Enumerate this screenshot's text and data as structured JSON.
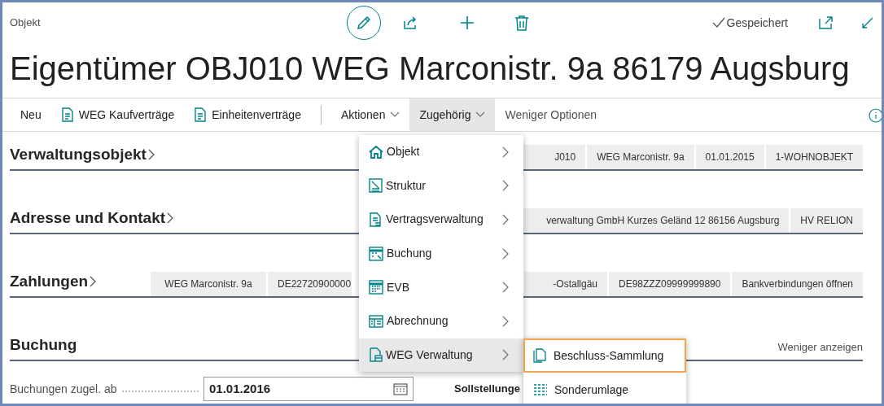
{
  "record_type": "Objekt",
  "save_status": "Gespeichert",
  "title": "Eigentümer OBJ010 WEG Marconistr. 9a 86179 Augsburg",
  "actions": [
    {
      "label": "Neu",
      "kind": "plain",
      "expanded": false
    },
    {
      "label": "WEG Kaufverträge",
      "kind": "icon",
      "expanded": false
    },
    {
      "label": "Einheitenverträge",
      "kind": "icon",
      "expanded": false
    },
    {
      "label": "Aktionen",
      "kind": "dropdown",
      "expanded": false
    },
    {
      "label": "Zugehörig",
      "kind": "dropdown",
      "expanded": true
    },
    {
      "label": "Weniger Optionen",
      "kind": "link",
      "expanded": false
    }
  ],
  "sections": [
    {
      "title": "Verwaltungsobjekt",
      "pills": [
        "J010",
        "WEG Marconistr. 9a",
        "01.01.2015",
        "1-WOHNOBJEKT"
      ]
    },
    {
      "title": "Adresse und Kontakt",
      "pills": [
        "verwaltung GmbH Kurzes Geländ 12 86156 Augsburg",
        "HV RELION"
      ]
    },
    {
      "title": "Zahlungen",
      "pills": [
        "WEG Marconistr. 9a",
        "DE22720900000",
        "-Ostallgäu",
        "DE98ZZZ09999999890",
        "Bankverbindungen öffnen"
      ]
    },
    {
      "title": "Buchung",
      "link": "Weniger anzeigen"
    }
  ],
  "field": {
    "label": "Buchungen zugel. ab",
    "value": "01.01.2016"
  },
  "next_field_label": "Sollstellunge",
  "menu": [
    {
      "label": "Objekt",
      "selected": false
    },
    {
      "label": "Struktur",
      "selected": false
    },
    {
      "label": "Vertragsverwaltung",
      "selected": false
    },
    {
      "label": "Buchung",
      "selected": false
    },
    {
      "label": "EVB",
      "selected": false
    },
    {
      "label": "Abrechnung",
      "selected": false
    },
    {
      "label": "WEG Verwaltung",
      "selected": true
    }
  ],
  "submenu": [
    {
      "label": "Beschluss-Sammlung",
      "selected": true
    },
    {
      "label": "Sonderumlage",
      "selected": false
    }
  ]
}
